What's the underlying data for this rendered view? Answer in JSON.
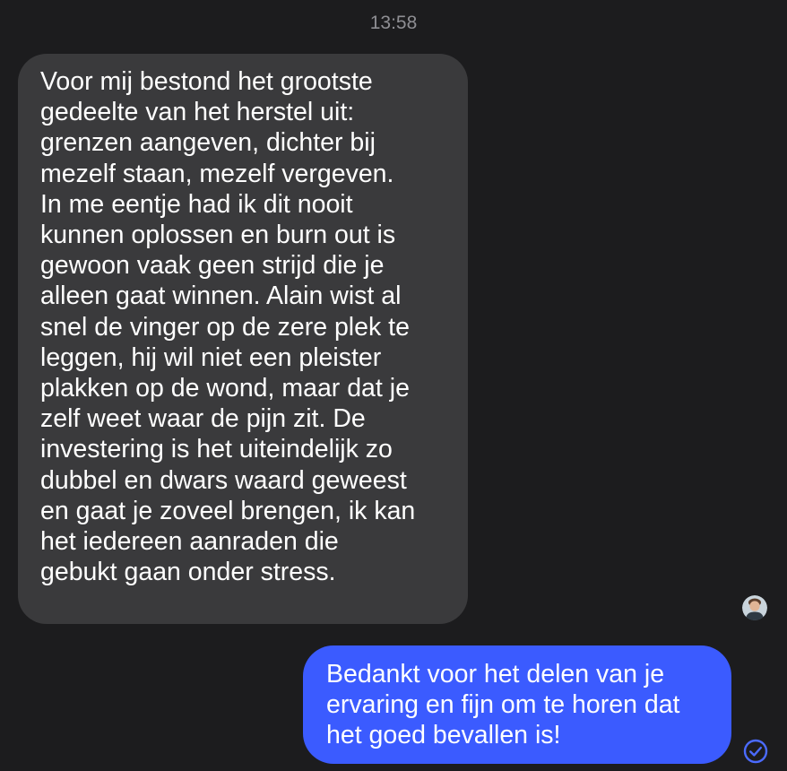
{
  "chat": {
    "timestamp": "13:58",
    "messages": [
      {
        "direction": "incoming",
        "text": "Voor mij bestond het grootste\ngedeelte van het herstel uit:\ngrenzen aangeven, dichter bij\nmezelf staan, mezelf vergeven.\nIn me eentje had ik dit nooit\nkunnen oplossen en burn out is\ngewoon vaak geen strijd die je\nalleen gaat winnen. Alain wist al\nsnel de vinger op de zere plek te\nleggen, hij wil niet een pleister\nplakken op de wond, maar dat je\nzelf weet waar de pijn zit. De\ninvestering is het uiteindelijk zo\ndubbel en dwars waard geweest\nen gaat je zoveel brengen, ik kan\nhet iedereen aanraden die\ngebukt gaan onder stress."
      },
      {
        "direction": "outgoing",
        "text": "Bedankt voor het delen van je\nervaring en fijn om te horen dat\nhet goed bevallen is!"
      }
    ],
    "read_receipt_icon": "avatar",
    "sent_status_icon": "check-circle-icon"
  },
  "colors": {
    "background": "#1c1c1e",
    "incoming_bubble": "#3a3a3c",
    "outgoing_bubble": "#3b5bff",
    "timestamp_text": "#8e8e93",
    "check": "#4b6bff"
  }
}
